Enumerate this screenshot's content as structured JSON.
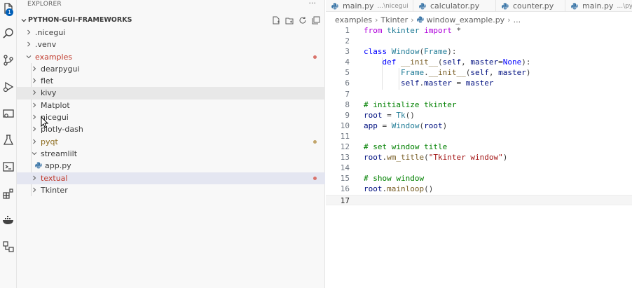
{
  "activity_bar": {
    "badge_count": "1",
    "icons": [
      "files-icon",
      "search-icon",
      "source-control-icon",
      "run-debug-icon",
      "remote-explorer-icon",
      "testing-icon",
      "terminal-icon",
      "extensions-icon",
      "docker-icon",
      "accounts-icon"
    ]
  },
  "sidebar": {
    "header": "EXPLORER",
    "more": "···",
    "section_title": "PYTHON-GUI-FRAMEWORKS",
    "items": [
      {
        "label": ".nicegui",
        "color": "#3b3b3b"
      },
      {
        "label": ".venv",
        "color": "#3b3b3b"
      },
      {
        "label": "examples",
        "color": "#c0392b",
        "dot": "#d9736b"
      },
      {
        "label": "dearpygui",
        "color": "#3b3b3b"
      },
      {
        "label": "flet",
        "color": "#3b3b3b"
      },
      {
        "label": "kivy",
        "color": "#3b3b3b"
      },
      {
        "label": "Matplot",
        "color": "#3b3b3b"
      },
      {
        "label": "nicegui",
        "color": "#3b3b3b"
      },
      {
        "label": "plotly-dash",
        "color": "#3b3b3b"
      },
      {
        "label": "pyqt",
        "color": "#8d6c1e",
        "dot": "#c2a56b"
      },
      {
        "label": "streamlilt",
        "color": "#3b3b3b"
      },
      {
        "label": "app.py",
        "color": "#3b3b3b"
      },
      {
        "label": "textual",
        "color": "#c0392b",
        "dot": "#d9736b"
      },
      {
        "label": "Tkinter",
        "color": "#3b3b3b"
      }
    ]
  },
  "editor": {
    "tabs": [
      {
        "name": "main.py",
        "desc": "...\\nicegui"
      },
      {
        "name": "calculator.py",
        "desc": ""
      },
      {
        "name": "counter.py",
        "desc": ""
      },
      {
        "name": "main.py",
        "desc": "...\\pyqt"
      }
    ],
    "breadcrumb": [
      "examples",
      "Tkinter",
      "window_example.py",
      "..."
    ],
    "current_line": 17,
    "lines": [
      {
        "n": "1",
        "html": "<span class='kw'>from</span> <span class='cls'>tkinter</span> <span class='kw'>import</span> *"
      },
      {
        "n": "2",
        "html": ""
      },
      {
        "n": "3",
        "html": "<span class='kw2'>class</span> <span class='cls'>Window</span>(<span class='cls'>Frame</span>):"
      },
      {
        "n": "4",
        "html": "    <span class='kw2'>def</span> <span class='fn'>__init__</span>(<span class='var'>self</span>, <span class='var'>master</span>=<span class='kw2'>None</span>):"
      },
      {
        "n": "5",
        "html": "        <span class='cls'>Frame</span>.<span class='fn'>__init__</span>(<span class='var'>self</span>, <span class='var'>master</span>)"
      },
      {
        "n": "6",
        "html": "        <span class='var'>self</span>.<span class='var'>master</span> = <span class='var'>master</span>"
      },
      {
        "n": "7",
        "html": ""
      },
      {
        "n": "8",
        "html": "<span class='cmt'># initialize tkinter</span>"
      },
      {
        "n": "9",
        "html": "<span class='var'>root</span> = <span class='cls'>Tk</span>()"
      },
      {
        "n": "10",
        "html": "<span class='var'>app</span> = <span class='cls'>Window</span>(<span class='var'>root</span>)"
      },
      {
        "n": "11",
        "html": ""
      },
      {
        "n": "12",
        "html": "<span class='cmt'># set window title</span>"
      },
      {
        "n": "13",
        "html": "<span class='var'>root</span>.<span class='fn'>wm_title</span>(<span class='str'>\"Tkinter window\"</span>)"
      },
      {
        "n": "14",
        "html": ""
      },
      {
        "n": "15",
        "html": "<span class='cmt'># show window</span>"
      },
      {
        "n": "16",
        "html": "<span class='var'>root</span>.<span class='fn'>mainloop</span>()"
      },
      {
        "n": "17",
        "html": ""
      }
    ]
  }
}
